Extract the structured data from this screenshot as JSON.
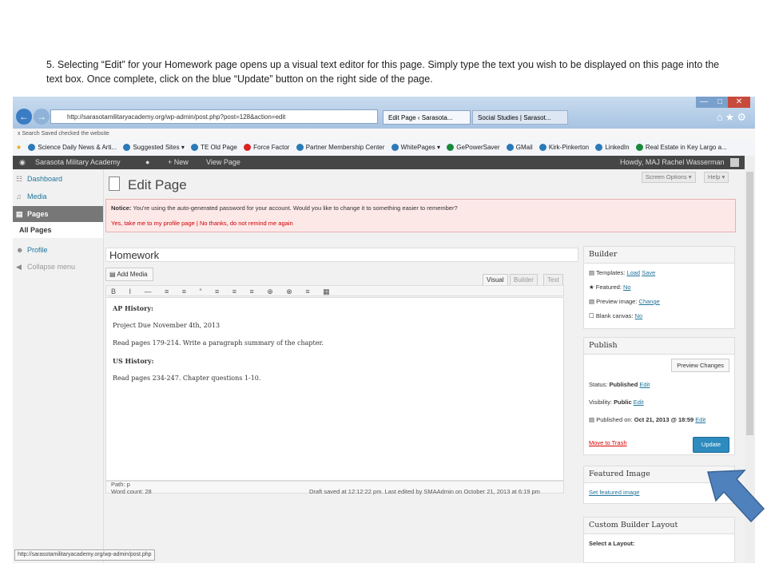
{
  "instruction": "5. Selecting “Edit” for your Homework page opens up a visual text editor for this page. Simply type the text you wish to be displayed on this page into the text box. Once complete, click on the blue “Update” button on the right side of the page.",
  "browser": {
    "url": "http://sarasotamilitaryacademy.org/wp-admin/post.php?post=128&action=edit",
    "tabs": [
      "Edit Page ‹ Sarasota...",
      "Social Studies | Sarasot..."
    ],
    "command_bar": "x   Search Saved checked the website",
    "favorites": [
      "Science Daily News & Arti...",
      "Suggested Sites ▾",
      "TE Old Page",
      "Force Factor",
      "Partner Membership Center",
      "WhitePages ▾",
      "GePowerSaver",
      "GMail",
      "Kirk-Pinkerton",
      "LinkedIn",
      "Real Estate in Key Largo a..."
    ]
  },
  "adminbar": {
    "site": "Sarasota Military Academy",
    "new": "+ New",
    "view": "View Page",
    "howdy": "Howdy, MAJ Rachel Wasserman"
  },
  "sidebar": {
    "dashboard": "Dashboard",
    "media": "Media",
    "pages": "Pages",
    "all_pages": "All Pages",
    "profile": "Profile",
    "collapse": "Collapse menu"
  },
  "main": {
    "title": "Edit Page",
    "screen_options": "Screen Options ▾",
    "help": "Help ▾",
    "notice_bold": "Notice:",
    "notice_text": " You're using the auto-generated password for your account. Would you like to change it to something easier to remember?",
    "notice_links": "Yes, take me to my profile page | No thanks, do not remind me again",
    "post_title": "Homework",
    "add_media": "Add Media",
    "tab_visual": "Visual",
    "tab_builder": "Builder",
    "tab_text": "Text",
    "toolbar_glyphs": "B I — ≡ ≡ “ ≡ ≡ ≡ ⊕ ⊗ ≡ ▦",
    "content": [
      {
        "text": "AP History:",
        "bold": true
      },
      {
        "text": "Project Due November 4th, 2013",
        "bold": false
      },
      {
        "text": "Read pages 179-214. Write a paragraph summary of the chapter.",
        "bold": false
      },
      {
        "text": "US History:",
        "bold": true
      },
      {
        "text": "Read pages 234-247. Chapter questions 1-10.",
        "bold": false
      }
    ],
    "path": "Path: p",
    "word_count": "Word count: 28",
    "draft_saved": "Draft saved at 12:12:22 pm. Last edited by SMAAdmin on October 21, 2013 at 6:19 pm"
  },
  "builder_box": {
    "title": "Builder",
    "templates_label": "Templates:",
    "load": "Load",
    "save": "Save",
    "featured_label": "★ Featured:",
    "featured_val": "No",
    "preview_label": "Preview image:",
    "preview_val": "Change",
    "blank_label": "Blank canvas:",
    "blank_val": "No"
  },
  "publish_box": {
    "title": "Publish",
    "preview_changes": "Preview Changes",
    "status_label": "Status:",
    "status_val": "Published",
    "edit": "Edit",
    "visibility_label": "Visibility:",
    "visibility_val": "Public",
    "published_label": "Published on:",
    "published_val": "Oct 21, 2013 @ 18:59",
    "move_trash": "Move to Trash",
    "update": "Update"
  },
  "featured_box": {
    "title": "Featured Image",
    "link": "Set featured image"
  },
  "custom_box": {
    "title": "Custom Builder Layout",
    "select": "Select a Layout:"
  },
  "statusbar": "http://sarasotamilitaryacademy.org/wp-admin/post.php",
  "colors": {
    "arrow": "#4f81bd",
    "update_button": "#2e8bbf",
    "adminbar": "#464646"
  }
}
